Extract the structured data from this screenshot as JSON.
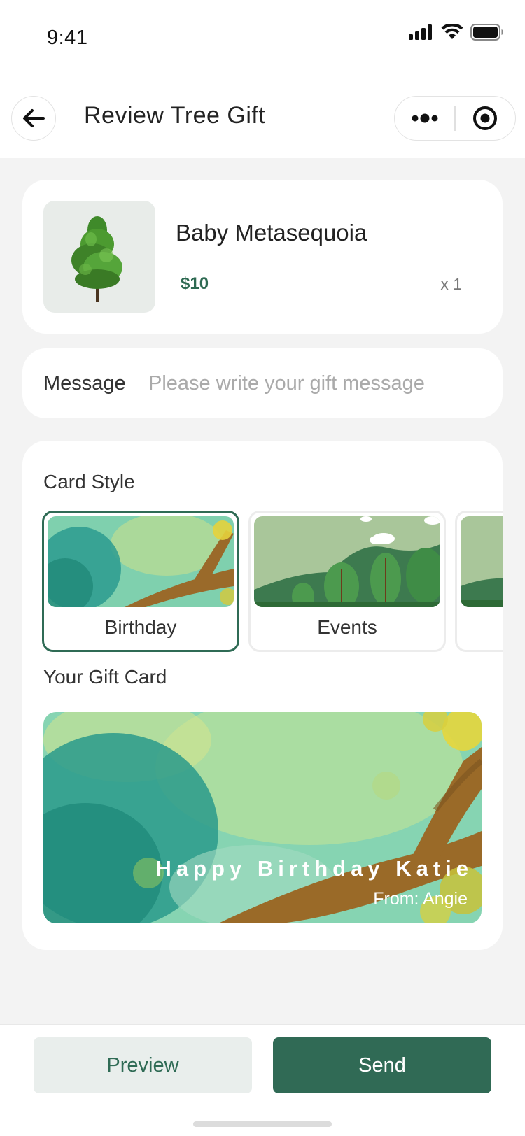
{
  "status": {
    "time": "9:41"
  },
  "nav": {
    "title": "Review Tree Gift",
    "back_icon": "arrow-left-icon",
    "more_icon": "more-dots-icon",
    "close_icon": "target-circle-icon"
  },
  "product": {
    "name": "Baby Metasequoia",
    "price": "$10",
    "quantity": "x 1",
    "image": "tree-icon"
  },
  "message": {
    "label": "Message",
    "placeholder": "Please write your gift message",
    "value": ""
  },
  "card_style": {
    "label": "Card Style",
    "options": [
      {
        "label": "Birthday",
        "selected": true
      },
      {
        "label": "Events",
        "selected": false
      },
      {
        "label": "",
        "selected": false
      }
    ]
  },
  "gift_card": {
    "label": "Your Gift Card",
    "greeting": "Happy Birthday Katie",
    "from": "From:  Angie"
  },
  "actions": {
    "preview_label": "Preview",
    "send_label": "Send"
  },
  "colors": {
    "accent": "#306a55",
    "price": "#2e6a52",
    "background": "#f3f3f3"
  }
}
